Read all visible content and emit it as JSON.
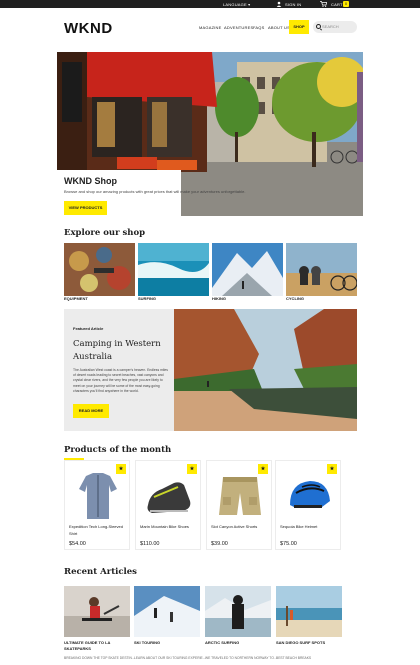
{
  "topbar": {
    "language": "LANGUAGE",
    "signin": "SIGN IN",
    "cart": "CART",
    "cart_count": "0"
  },
  "header": {
    "logo": "WKND",
    "nav": [
      "MAGAZINE",
      "ADVENTURES",
      "FAQS",
      "ABOUT US"
    ],
    "active": "SHOP",
    "search_placeholder": "SEARCH"
  },
  "hero": {
    "title": "WKND Shop",
    "text": "Browse and shop our amazing products with great prices that will make your adventures unforgettable.",
    "button": "VIEW PRODUCTS"
  },
  "explore": {
    "title": "Explore our shop",
    "categories": [
      "EQUIPMENT",
      "SURFING",
      "HIKING",
      "CYCLING"
    ]
  },
  "featured": {
    "kicker": "Featured Article",
    "title": "Camping in Western Australia",
    "description": "The Australian West coast is a camper's heaven. Endless miles of desert roads leading to secret beaches, vast canyons and crystal clear rivers, and the very few people you are likely to meet on your journey will be some of the most easy-going characters you'll find anywhere in the world.",
    "button": "READ MORE"
  },
  "products": {
    "title": "Products of the month",
    "items": [
      {
        "name": "Expedition Tech Long-Sleeved Shirt",
        "price": "$54.00",
        "icon": "shirt-icon"
      },
      {
        "name": "Marin Mountain Bike Shoes",
        "price": "$110.00",
        "icon": "shoe-icon"
      },
      {
        "name": "Slot Canyon Active Shorts",
        "price": "$39.00",
        "icon": "shorts-icon"
      },
      {
        "name": "Sequoia Bike Helmet",
        "price": "$75.00",
        "icon": "helmet-icon"
      }
    ]
  },
  "articles": {
    "title": "Recent Articles",
    "items": [
      {
        "title": "ULTIMATE GUIDE TO LA SKATEPARKS",
        "sub": "BREAKING DOWN THE TOP SKATE DESTIN..."
      },
      {
        "title": "SKI TOURING",
        "sub": "LEARN ABOUT OUR SKI TOURING EXPERIE..."
      },
      {
        "title": "ARCTIC SURFING",
        "sub": "WE TRAVELED TO NORTHERN NORWAY TO..."
      },
      {
        "title": "SAN DIEGO SURF SPOTS",
        "sub": "BEST BEACH BREAKS"
      }
    ]
  },
  "colors": {
    "accent": "#ffea00",
    "dark": "#202020",
    "panel": "#ececec"
  }
}
